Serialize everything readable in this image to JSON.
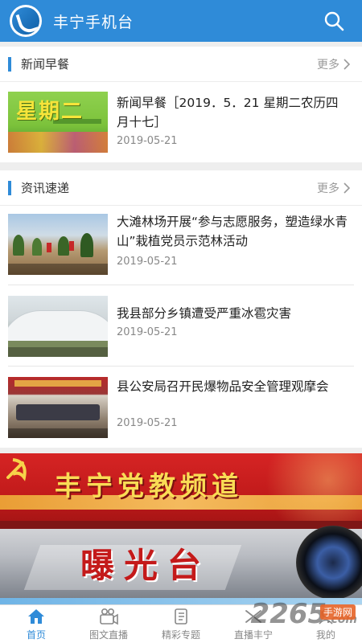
{
  "header": {
    "title": "丰宁手机台",
    "logo_icon": "station-logo-icon",
    "search_icon": "search-icon"
  },
  "news": {
    "title": "新闻早餐",
    "more": "更多",
    "items": [
      {
        "title": "新闻早餐［2019．5．21 星期二农历四月十七］",
        "date": "2019-05-21",
        "thumb_text": "星期二"
      }
    ]
  },
  "express": {
    "title": "资讯速递",
    "more": "更多",
    "items": [
      {
        "title": "大滩林场开展“参与志愿服务，塑造绿水青山”栽植党员示范林活动",
        "date": "2019-05-21"
      },
      {
        "title": "我县部分乡镇遭受严重冰雹灾害",
        "date": "2019-05-21"
      },
      {
        "title": "县公安局召开民爆物品安全管理观摩会",
        "date": "2019-05-21"
      }
    ]
  },
  "banners": {
    "party": "丰宁党教频道",
    "exposure": "曝光台"
  },
  "tabs": [
    {
      "label": "首页",
      "icon": "home-icon",
      "active": true
    },
    {
      "label": "图文直播",
      "icon": "video-camera-icon",
      "active": false
    },
    {
      "label": "精彩专题",
      "icon": "topic-book-icon",
      "active": false
    },
    {
      "label": "直播丰宁",
      "icon": "live-broadcast-icon",
      "active": false
    },
    {
      "label": "我的",
      "icon": "profile-icon",
      "active": false
    }
  ],
  "watermark": {
    "brand": "2265",
    "sub": "手游网",
    "suffix": ".com"
  },
  "colors": {
    "primary": "#2f8bd8",
    "party_red": "#c81d1d",
    "active_tab": "#2f8bd8"
  }
}
